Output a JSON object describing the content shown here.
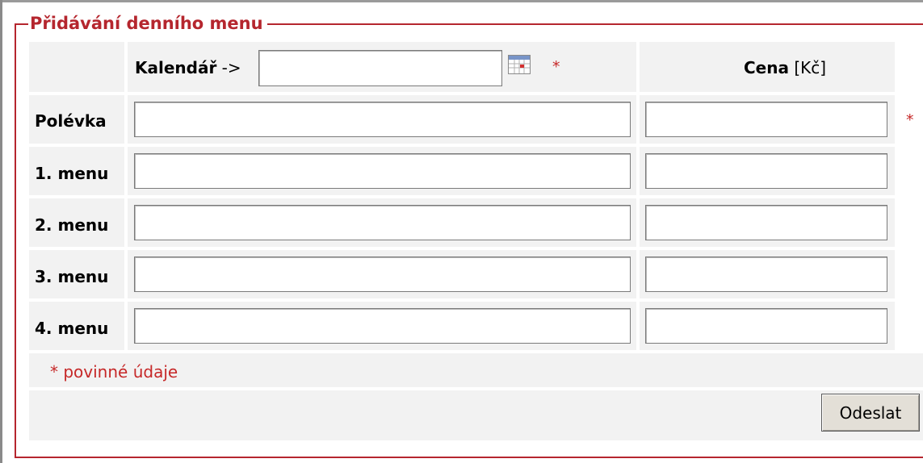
{
  "form": {
    "legend": "Přidávání denního menu",
    "calendar": {
      "label_bold": "Kalendář",
      "label_arrow": " ->",
      "value": "",
      "required_mark": "*",
      "icon": "calendar-icon"
    },
    "price_header": {
      "label_bold": "Cena",
      "unit": " [Kč]"
    },
    "rows": [
      {
        "label": "Polévka",
        "dish_value": "",
        "price_value": "",
        "required_mark": "*"
      },
      {
        "label": "1. menu",
        "dish_value": "",
        "price_value": ""
      },
      {
        "label": "2. menu",
        "dish_value": "",
        "price_value": ""
      },
      {
        "label": "3. menu",
        "dish_value": "",
        "price_value": ""
      },
      {
        "label": "4. menu",
        "dish_value": "",
        "price_value": ""
      }
    ],
    "required_note": "* povinné údaje",
    "submit_label": "Odeslat"
  },
  "colors": {
    "accent": "#b5262e",
    "required": "#c62828",
    "cell_background": "#f2f2f2",
    "button_face": "#e3dfd7"
  }
}
